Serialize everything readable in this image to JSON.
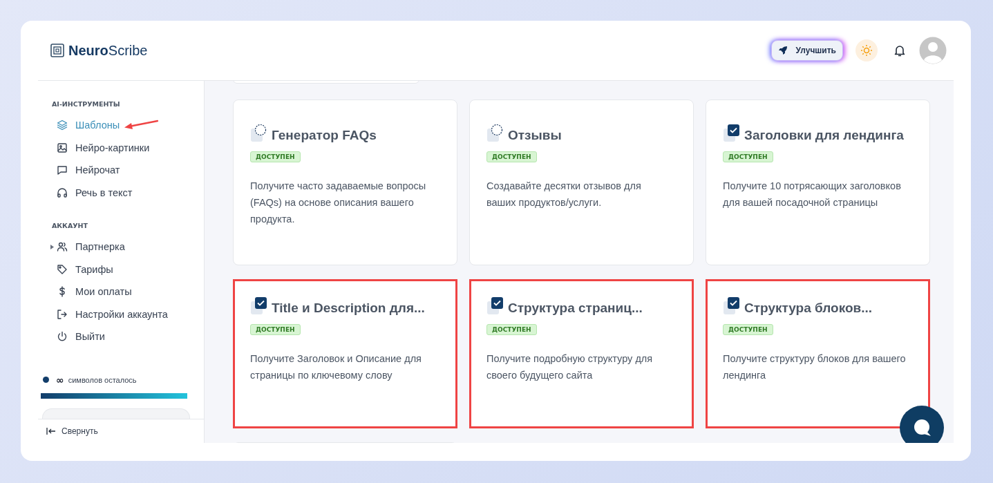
{
  "brand": {
    "part_bold": "Neuro",
    "part_light": "Scribe"
  },
  "header": {
    "upgrade_label": "Улучшить"
  },
  "sidebar": {
    "sections": [
      {
        "title": "AI-ИНСТРУМЕНТЫ",
        "items": [
          {
            "label": "Шаблоны",
            "kind": "layers",
            "selected": true,
            "expandable": false
          },
          {
            "label": "Нейро-картинки",
            "kind": "image",
            "selected": false,
            "expandable": false
          },
          {
            "label": "Нейрочат",
            "kind": "chat",
            "selected": false,
            "expandable": false
          },
          {
            "label": "Речь в текст",
            "kind": "headphones",
            "selected": false,
            "expandable": false
          }
        ]
      },
      {
        "title": "АККАУНТ",
        "items": [
          {
            "label": "Партнерка",
            "kind": "users",
            "selected": false,
            "expandable": true
          },
          {
            "label": "Тарифы",
            "kind": "tag",
            "selected": false,
            "expandable": false
          },
          {
            "label": "Мои оплаты",
            "kind": "dollar",
            "selected": false,
            "expandable": false
          },
          {
            "label": "Настройки аккаунта",
            "kind": "exit",
            "selected": false,
            "expandable": false
          },
          {
            "label": "Выйти",
            "kind": "power",
            "selected": false,
            "expandable": false
          }
        ]
      }
    ],
    "credits": {
      "symbol": "∞",
      "label": "символов осталось",
      "level": 1
    },
    "collapse_label": "Свернуть"
  },
  "cards": [
    {
      "title": "Генератор FAQs",
      "kind": "dashed",
      "badge": "ДОСТУПЕН",
      "description": "Получите часто задаваемые вопросы (FAQs) на основе описания вашего продукта.",
      "highlighted": false
    },
    {
      "title": "Отзывы",
      "kind": "dashed",
      "badge": "ДОСТУПЕН",
      "description": "Создавайте десятки отзывов для ваших продуктов/услуги.",
      "highlighted": false
    },
    {
      "title": "Заголовки для лендинга",
      "kind": "check",
      "badge": "ДОСТУПЕН",
      "description": "Получите 10 потрясающих заголовков для вашей посадочной страницы",
      "highlighted": false
    },
    {
      "title": "Title и Description для...",
      "kind": "check",
      "badge": "ДОСТУПЕН",
      "description": "Получите Заголовок и Описание для страницы по ключевому слову",
      "highlighted": true
    },
    {
      "title": "Структура страниц...",
      "kind": "check",
      "badge": "ДОСТУПЕН",
      "description": "Получите подробную структуру для своего будущего сайта",
      "highlighted": true
    },
    {
      "title": "Структура блоков...",
      "kind": "check",
      "badge": "ДОСТУПЕН",
      "description": "Получите структуру блоков для вашего лендинга",
      "highlighted": true
    }
  ]
}
